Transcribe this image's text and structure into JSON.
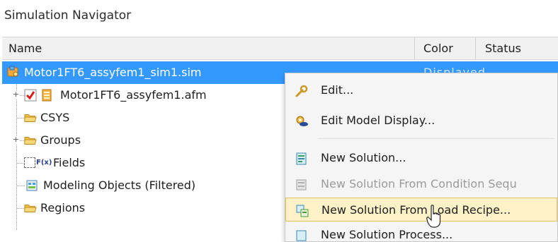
{
  "panel": {
    "title": "Simulation Navigator"
  },
  "columns": {
    "name": "Name",
    "color": "Color",
    "status": "Status"
  },
  "tree": {
    "root": {
      "label": "Motor1FT6_assyfem1_sim1.sim",
      "status_partial": "Displayed"
    },
    "items": [
      {
        "label": "Motor1FT6_assyfem1.afm"
      },
      {
        "label": "CSYS"
      },
      {
        "label": "Groups"
      },
      {
        "label": "Fields"
      },
      {
        "label": "Modeling Objects (Filtered)"
      },
      {
        "label": "Regions"
      }
    ],
    "fields_badge": "F(x)"
  },
  "context_menu": {
    "items": [
      {
        "label": "Edit...",
        "icon": "wrench-icon",
        "enabled": true
      },
      {
        "label": "Edit Model Display...",
        "icon": "display-gear-icon",
        "enabled": true
      },
      {
        "label": "New Solution...",
        "icon": "solution-icon",
        "enabled": true
      },
      {
        "label": "New Solution From Condition Sequ",
        "icon": "solution-sequence-icon",
        "enabled": false
      },
      {
        "label": "New Solution From Load Recipe...",
        "icon": "load-recipe-icon",
        "enabled": true,
        "highlighted": true
      },
      {
        "label": "New Solution Process...",
        "icon": "solution-process-icon",
        "enabled": true
      }
    ]
  },
  "colors": {
    "selection": "#3399ff",
    "highlight": "#fdf1c7",
    "checkbox_red": "#d62020",
    "folder_yellow": "#f2c04a"
  }
}
